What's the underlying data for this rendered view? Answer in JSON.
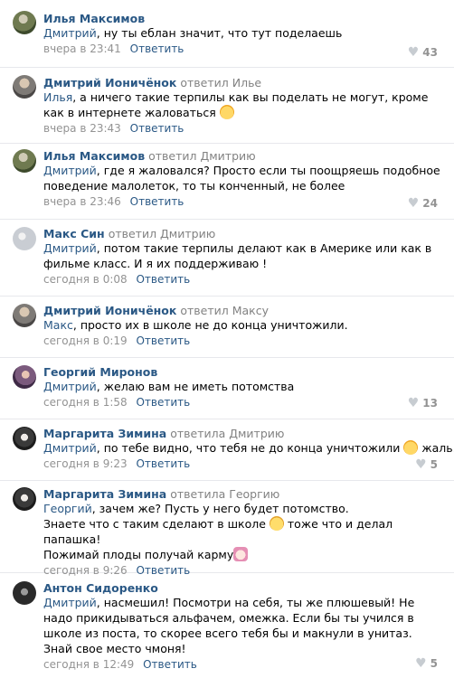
{
  "comments": [
    {
      "author": "Илья Максимов",
      "reply_to": "",
      "mention": "Дмитрий",
      "text": ", ну ты еблан значит, что тут поделаешь",
      "time": "вчера в 23:41",
      "reply_label": "Ответить",
      "likes": "43",
      "avatar": "avatar-ilya"
    },
    {
      "author": "Дмитрий Ионичёнок",
      "reply_to": "ответил Илье",
      "mention": "Илья",
      "text": ", а ничего такие терпилы как вы поделать не могут, кроме как в интернете жаловаться",
      "emoji": "rofl-icon",
      "time": "вчера в 23:43",
      "reply_label": "Ответить",
      "likes": "",
      "avatar": "avatar-dmitry"
    },
    {
      "author": "Илья Максимов",
      "reply_to": "ответил Дмитрию",
      "mention": "Дмитрий",
      "text": ", где я жаловался? Просто если ты поощряешь подобное поведение малолеток, то ты конченный, не более",
      "time": "вчера в 23:46",
      "reply_label": "Ответить",
      "likes": "24",
      "avatar": "avatar-ilya"
    },
    {
      "author": "Макс Син",
      "reply_to": "ответил Дмитрию",
      "mention": "Дмитрий",
      "text": ", потом такие терпилы делают как в Америке или как в фильме класс. И я их поддерживаю !",
      "time": "сегодня в 0:08",
      "reply_label": "Ответить",
      "likes": "",
      "avatar": "avatar-maks"
    },
    {
      "author": "Дмитрий Ионичёнок",
      "reply_to": "ответил Максу",
      "mention": "Макс",
      "text": ", просто их в школе не до конца уничтожили.",
      "time": "сегодня в 0:19",
      "reply_label": "Ответить",
      "likes": "",
      "avatar": "avatar-dmitry"
    },
    {
      "author": "Георгий Миронов",
      "reply_to": "",
      "mention": "Дмитрий",
      "text": ", желаю вам не иметь потомства",
      "time": "сегодня в 1:58",
      "reply_label": "Ответить",
      "likes": "13",
      "avatar": "avatar-georgiy"
    },
    {
      "author": "Маргарита Зимина",
      "reply_to": "ответила Дмитрию",
      "mention": "Дмитрий",
      "text": ", по тебе видно, что тебя не до конца уничтожили",
      "text_after": " жаль...",
      "emoji": "smirk-icon",
      "time": "сегодня в 9:23",
      "reply_label": "Ответить",
      "likes": "5",
      "avatar": "avatar-margarita"
    },
    {
      "author": "Маргарита Зимина",
      "reply_to": "ответила Георгию",
      "mention": "Георгий",
      "text": ", зачем же? Пусть у него будет потомство.",
      "line2": "Знаете что с таким сделают в школе",
      "line2_after": " тоже что и делал папашка!",
      "line3": "Пожимай плоды получай карму",
      "time": "сегодня в 9:26",
      "reply_label": "Ответить",
      "likes": "",
      "avatar": "avatar-margarita"
    },
    {
      "author": "Антон Сидоренко",
      "reply_to": "",
      "mention": "Дмитрий",
      "text": ", насмешил! Посмотри на себя, ты же плюшевый! Не надо прикидываться альфачем, омежка. Если бы ты учился в школе из поста, то скорее всего тебя бы и макнули в унитаз. Знай свое место чмоня!",
      "time": "сегодня в 12:49",
      "reply_label": "Ответить",
      "likes": "5",
      "avatar": "avatar-anton"
    }
  ]
}
